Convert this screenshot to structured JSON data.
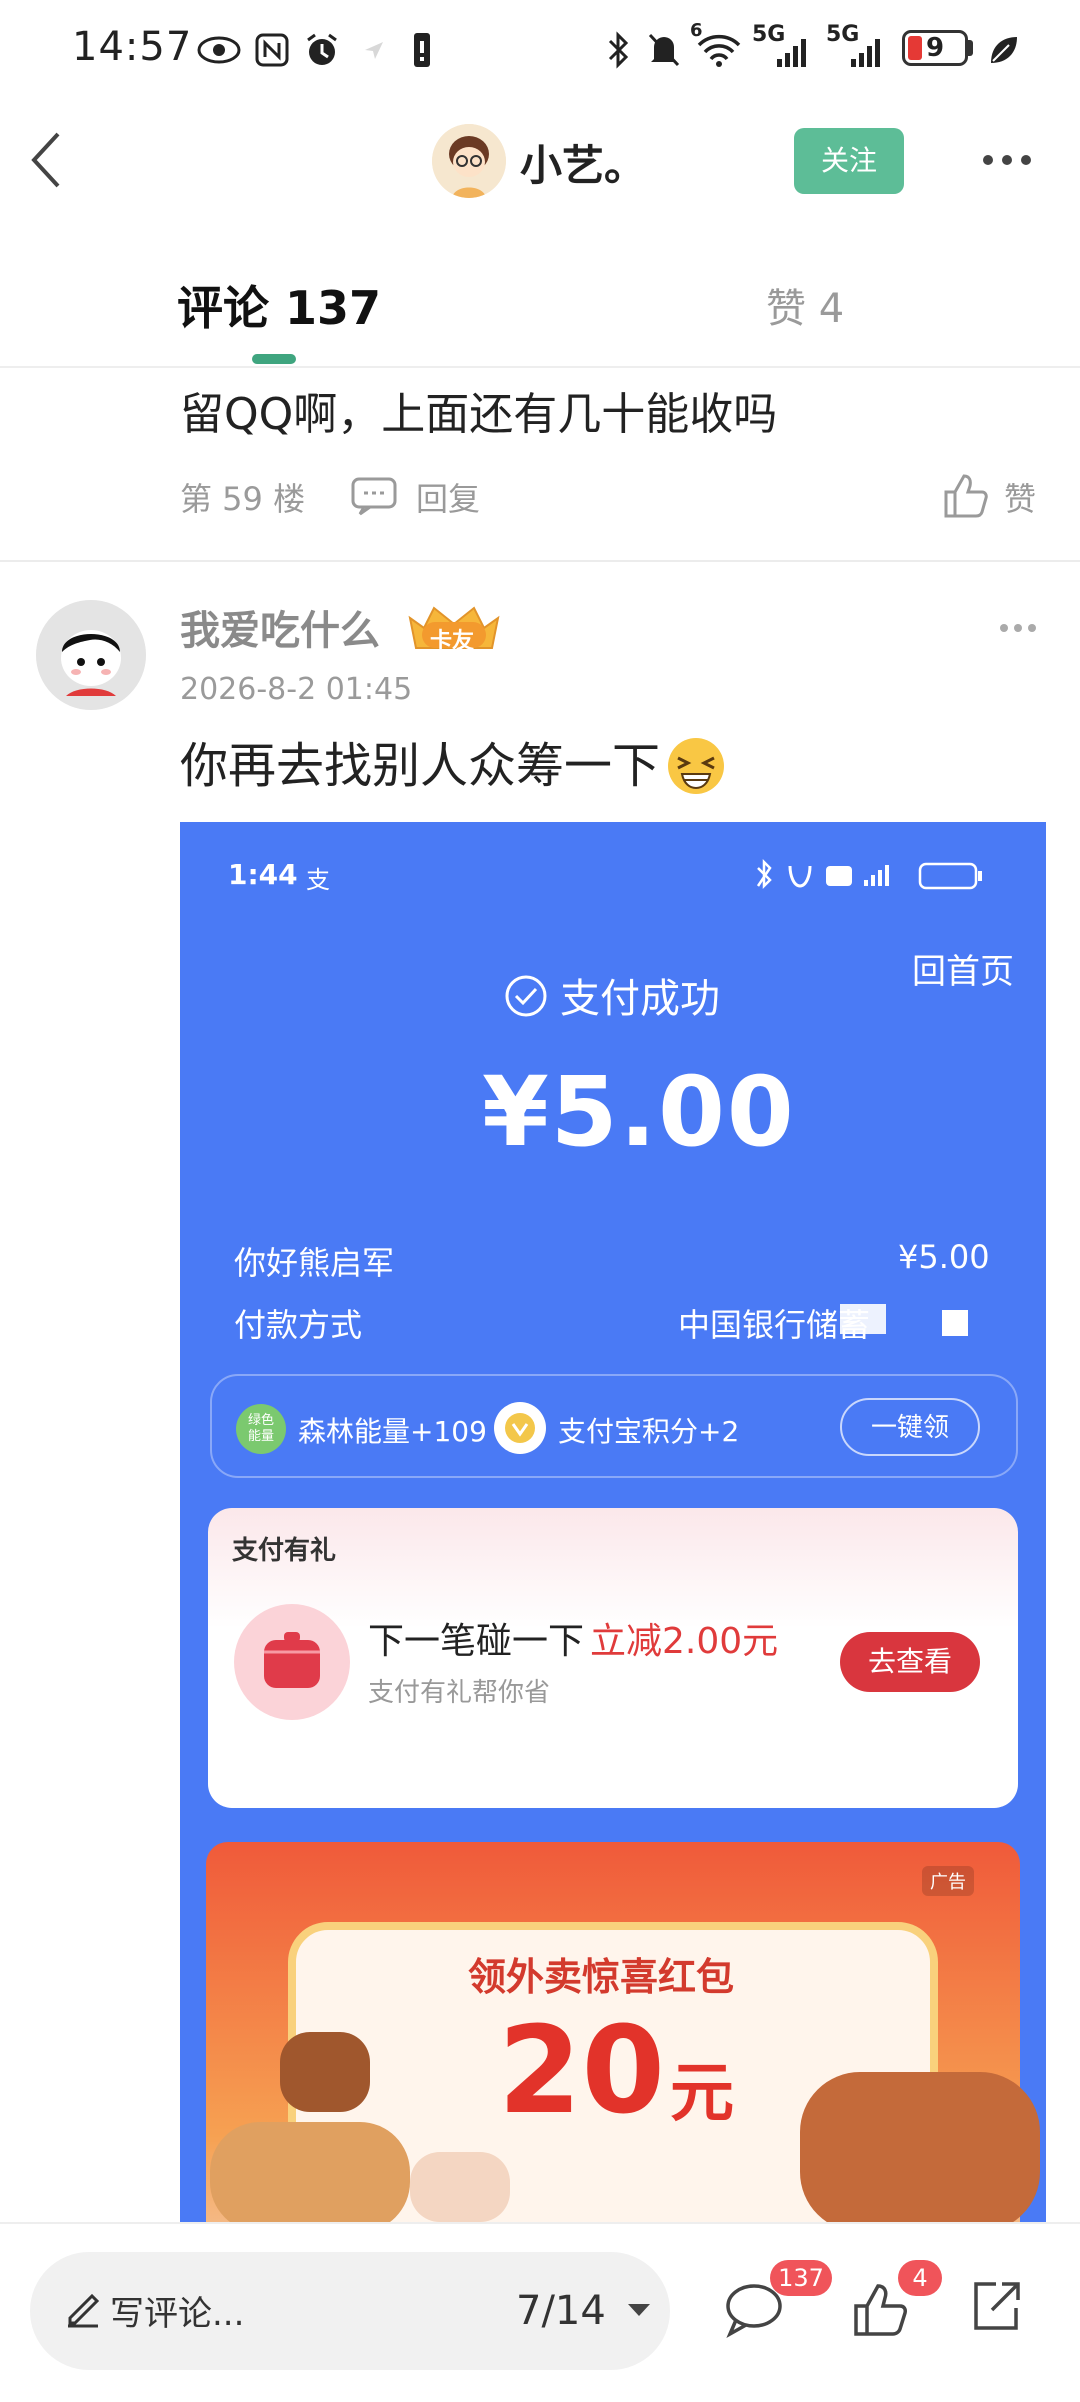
{
  "status_bar": {
    "time": "14:57",
    "icons": [
      "eye-icon",
      "nfc-icon",
      "alarm-icon",
      "location-icon",
      "notification-icon",
      "bluetooth-icon",
      "mute-icon",
      "wifi-icon",
      "signal-icon",
      "signal-icon",
      "battery-icon",
      "leaf-icon"
    ],
    "wifi_label": "6",
    "signal1_label": "5G",
    "signal2_label": "5G",
    "battery": "9"
  },
  "header": {
    "name": "小艺。",
    "follow_label": "关注"
  },
  "tabs": {
    "comments": "评论 137",
    "likes": "赞 4"
  },
  "prev_comment": {
    "text": "留QQ啊，上面还有几十能收吗",
    "floor": "第 59 楼",
    "reply_label": "回复",
    "like_label": "赞"
  },
  "comment": {
    "username": "我爱吃什么",
    "badge": "卡友",
    "timestamp": "2026-8-2 01:45",
    "text": "你再去找别人众筹一下",
    "emoji": "grinning-squint-emoji",
    "screenshot": {
      "time": "1:44",
      "app_mark": "支",
      "home_link": "回首页",
      "status": "支付成功",
      "amount": "¥5.00",
      "greeting_label": "你好熊启军",
      "greeting_value": "¥5.00",
      "pay_method_label": "付款方式",
      "pay_method_value": "中国银行储蓄",
      "energy_icon_text": "绿色\n能量",
      "energy": "森林能量+109",
      "points": "支付宝积分+2",
      "onekey": "一键领",
      "card_title": "支付有礼",
      "next_text": "下一笔碰一下",
      "discount": "立减2.00元",
      "next_sub": "支付有礼帮你省",
      "view_btn": "去查看",
      "ad_label": "广告",
      "banner_title": "领外卖惊喜红包",
      "banner_amount": "20",
      "banner_unit": "元"
    }
  },
  "bottom_bar": {
    "write_label": "写评论...",
    "page": "7/14",
    "comment_count": "137",
    "like_count": "4"
  },
  "colors": {
    "accent": "#5dbd97",
    "tab_indicator": "#3fa57f",
    "badge_red": "#f0545a",
    "alipay_blue": "#4a7af5"
  }
}
